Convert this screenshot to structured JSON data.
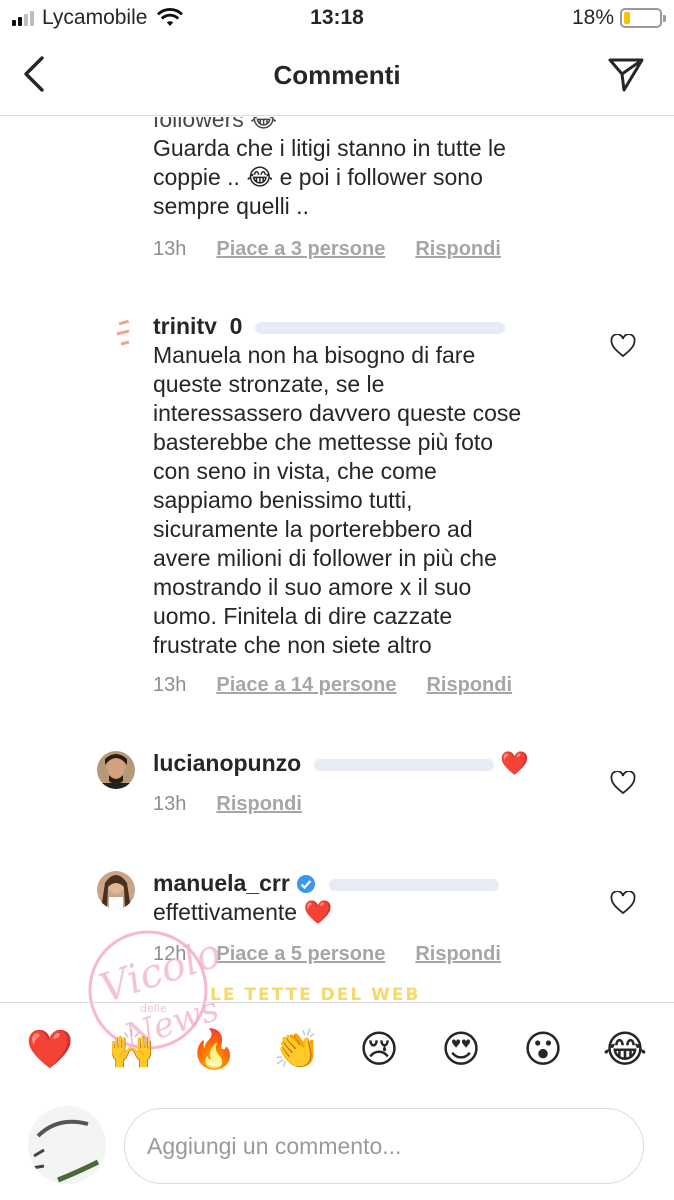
{
  "status_bar": {
    "carrier": "Lycamobile",
    "time": "13:18",
    "battery": "18%",
    "battery_level": 0.18
  },
  "nav": {
    "title": "Commenti",
    "back_icon": "chevron-left-icon",
    "send_icon": "paper-plane-icon"
  },
  "comments": [
    {
      "username_partial": "",
      "lines": [
        "followers 😂",
        "Guarda che i litigi stanno in tutte le",
        "coppie .. 😂  e poi i follower sono",
        "sempre quelli .."
      ],
      "time": "13h",
      "likes": "Piace a 3 persone",
      "reply": "Rispondi"
    },
    {
      "username": "trinity_0",
      "lines": [
        "Manuela non ha bisogno di fare",
        "queste  stronzate, se le",
        "interessassero davvero queste cose",
        "basterebbe che mettesse più foto",
        "con seno in vista, che come",
        "sappiamo benissimo tutti,",
        "sicuramente la porterebbero ad",
        "avere milioni di follower in più che",
        "mostrando il suo amore x il suo",
        "uomo. Finitela di dire cazzate",
        "frustrate che non siete altro"
      ],
      "time": "13h",
      "likes": "Piace a 14 persone",
      "reply": "Rispondi"
    },
    {
      "username": "lucianopunzo",
      "text": "❤️",
      "time": "13h",
      "reply": "Rispondi"
    },
    {
      "username": "manuela_crr",
      "text": "effettivamente ❤️",
      "time": "12h",
      "likes": "Piace a 5 persone",
      "reply": "Rispondi"
    }
  ],
  "emoji_bar": [
    "❤️",
    "🙌",
    "🔥",
    "👏",
    "😢",
    "😍",
    "😮",
    "😂"
  ],
  "input": {
    "placeholder": "Aggiungi un commento..."
  },
  "watermark": {
    "text1": "Vicolo delle News",
    "text2": "le tette del web"
  },
  "colors": {
    "accent_heart": "#e2222b",
    "verified": "#3897f0",
    "meta_gray": "#8e8e8e",
    "battery_yellow": "#f5c400"
  }
}
